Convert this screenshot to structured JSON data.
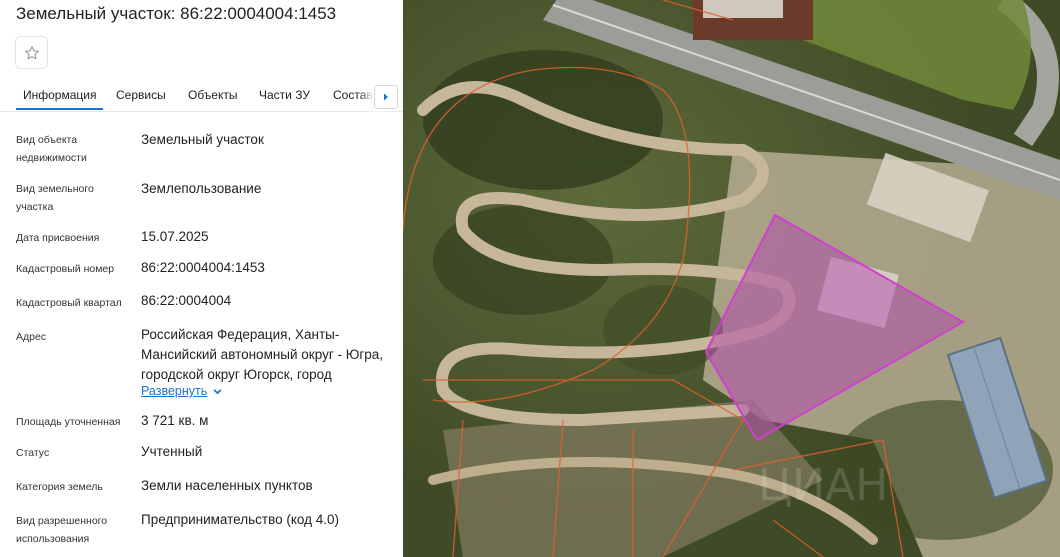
{
  "header": {
    "title": "Земельный участок: 86:22:0004004:1453"
  },
  "tabs": [
    {
      "label": "Информация",
      "active": true
    },
    {
      "label": "Сервисы"
    },
    {
      "label": "Объекты"
    },
    {
      "label": "Части ЗУ"
    },
    {
      "label": "Состав"
    }
  ],
  "fields": {
    "object_type": {
      "label": "Вид объекта недвижимости",
      "value": "Земельный участок"
    },
    "land_type": {
      "label": "Вид земельного участка",
      "value": "Землепользование"
    },
    "assign_date": {
      "label": "Дата присвоения",
      "value": "15.07.2025"
    },
    "cadastral_number": {
      "label": "Кадастровый номер",
      "value": "86:22:0004004:1453"
    },
    "cadastral_block": {
      "label": "Кадастровый квартал",
      "value": "86:22:0004004"
    },
    "address": {
      "label": "Адрес",
      "value": "Российская Федерация, Ханты-Мансийский автономный округ - Югра, городской округ Югорск, город",
      "expand_label": "Развернуть"
    },
    "area": {
      "label": "Площадь уточненная",
      "value": "3 721 кв. м"
    },
    "status": {
      "label": "Статус",
      "value": "Учтенный"
    },
    "category": {
      "label": "Категория земель",
      "value": "Земли населенных пунктов"
    },
    "permitted_use": {
      "label": "Вид разрешенного использования",
      "value": "Предпринимательство (код 4.0)"
    }
  },
  "colors": {
    "accent": "#1a73c8",
    "parcel_fill": "#b43cb4",
    "parcel_stroke": "#d040d0",
    "boundary": "#e06030"
  },
  "icons": {
    "favorite": "star-icon",
    "tabs_next": "chevron-right-icon",
    "expand": "chevron-down-icon"
  }
}
